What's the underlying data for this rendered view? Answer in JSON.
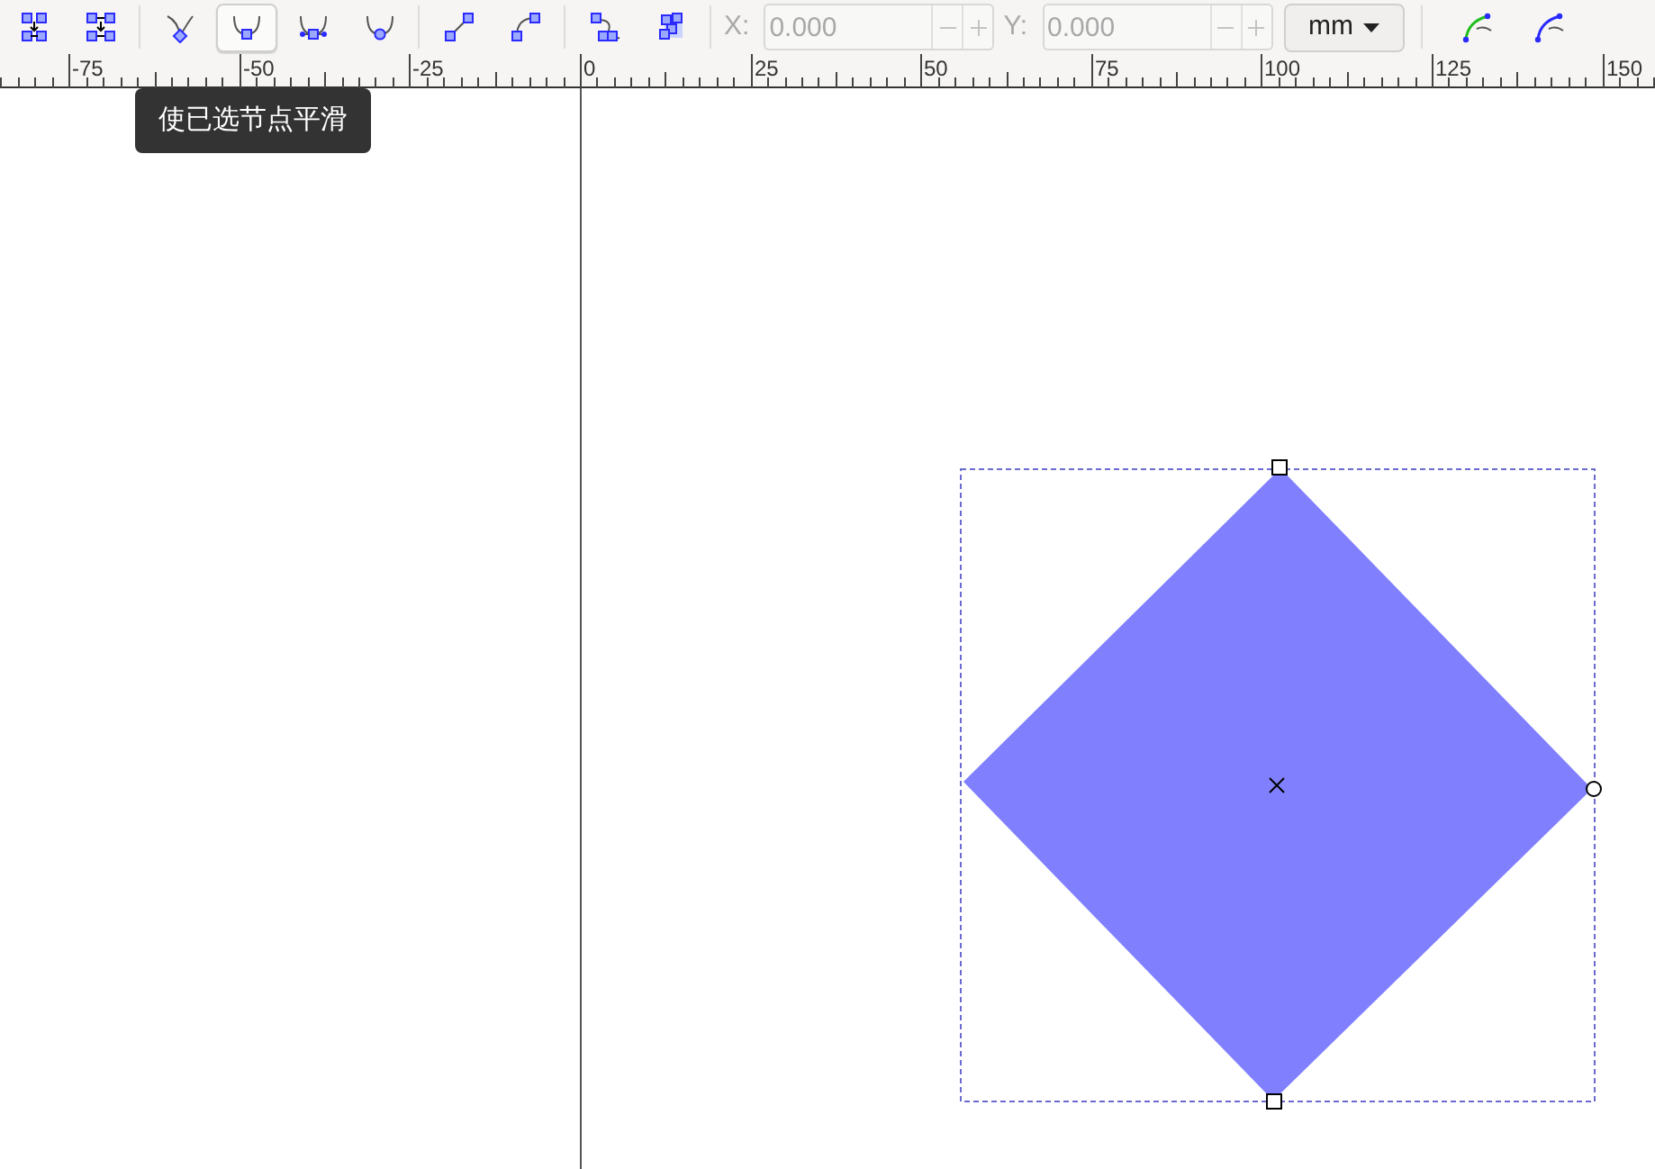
{
  "toolbar": {
    "node_buttons": [
      {
        "selected": false
      },
      {
        "selected": false
      },
      {
        "selected": false
      },
      {
        "selected": true
      },
      {
        "selected": false
      },
      {
        "selected": false
      },
      {
        "selected": false
      },
      {
        "selected": false
      },
      {
        "selected": false
      },
      {
        "selected": false
      }
    ],
    "x_field": {
      "label": "X:",
      "value": "0.000",
      "disabled": true
    },
    "y_field": {
      "label": "Y:",
      "value": "0.000",
      "disabled": true
    },
    "unit_dropdown": {
      "value": "mm"
    }
  },
  "ruler": {
    "labels": [
      "-75",
      "-50",
      "-25",
      "0",
      "25",
      "50",
      "75",
      "100",
      "125",
      "150"
    ]
  },
  "tooltip": {
    "text": "使已选节点平滑"
  }
}
